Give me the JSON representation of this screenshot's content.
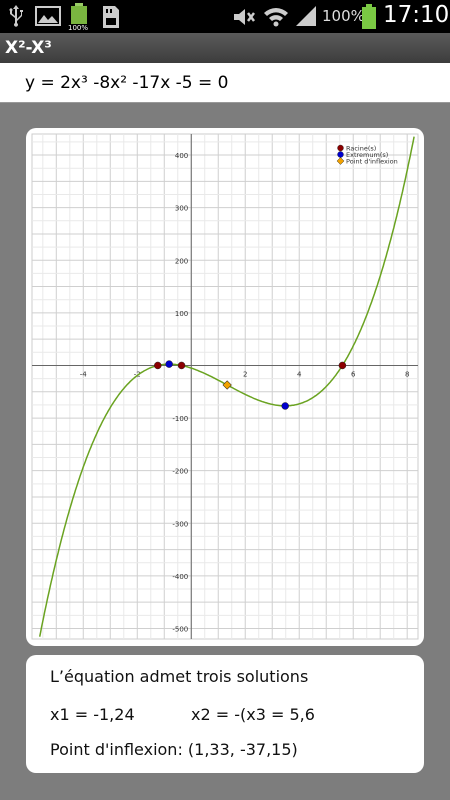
{
  "status_bar": {
    "battery_percent": "100%",
    "time": "17:10",
    "mini_battery_label": "100%"
  },
  "app": {
    "title": "X²-X³",
    "equation": "y = 2x³ -8x² -17x -5 = 0"
  },
  "chart_data": {
    "type": "line",
    "function": "2x^3 - 8x^2 - 17x - 5",
    "coefficients": [
      2,
      -8,
      -17,
      -5
    ],
    "xlim": [
      -5.9,
      8.4
    ],
    "ylim": [
      -520,
      440
    ],
    "x_ticks": [
      -4,
      -2,
      2,
      4,
      6,
      8
    ],
    "y_ticks": [
      400,
      300,
      200,
      100,
      -100,
      -200,
      -300,
      -400,
      -500
    ],
    "grid": true,
    "legend_position": "top-right",
    "legend": [
      {
        "label": "Racine(s)",
        "color": "#8b0000"
      },
      {
        "label": "Extremum(s)",
        "color": "#0000cc"
      },
      {
        "label": "Point d'inflexion",
        "color": "#f2a200"
      }
    ],
    "roots": [
      {
        "x": -1.24,
        "y": 0
      },
      {
        "x": -0.36,
        "y": 0
      },
      {
        "x": 5.6,
        "y": 0
      }
    ],
    "extrema": [
      {
        "x": -0.82,
        "y": 2.6
      },
      {
        "x": 3.48,
        "y": -77
      }
    ],
    "inflection": {
      "x": 1.33,
      "y": -37.15
    },
    "curve_color": "#6aa321"
  },
  "result": {
    "summary": "L’équation admet trois solutions",
    "x1": "x1 = -1,24",
    "x2": "x2 = -(x3 = 5,6",
    "inflection": "Point d'inflexion: (1,33, -37,15)"
  }
}
